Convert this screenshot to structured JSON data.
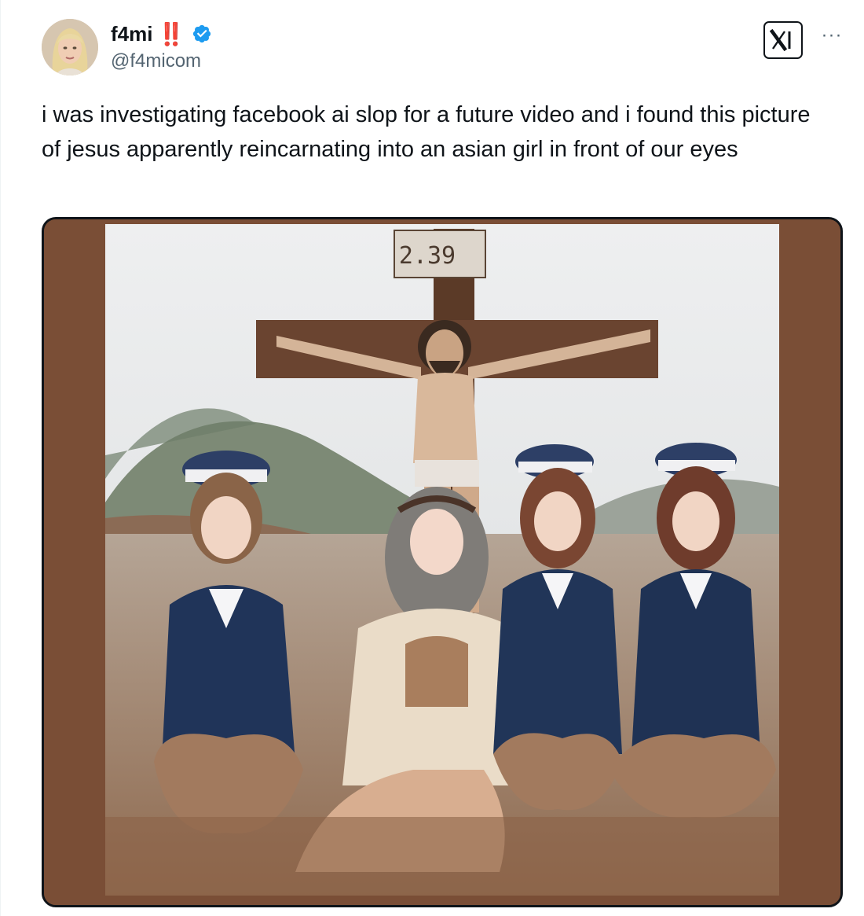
{
  "author": {
    "display_name": "f4mi",
    "name_emoji": "‼️",
    "handle": "@f4micom",
    "verified": true,
    "avatar_icon": "avatar-portrait-icon"
  },
  "header_actions": {
    "x_badge_icon": "x-logo-icon",
    "more_label": "···"
  },
  "tweet": {
    "text": "i was investigating facebook ai slop for a future video and i found this picture of jesus apparently reincarnating into an asian girl in front of our eyes"
  },
  "media": {
    "sign_text": "2.39",
    "frame_color": "#7a4e36",
    "verified_color": "#1d9bf0",
    "bangbang_color": "#d9243f"
  }
}
